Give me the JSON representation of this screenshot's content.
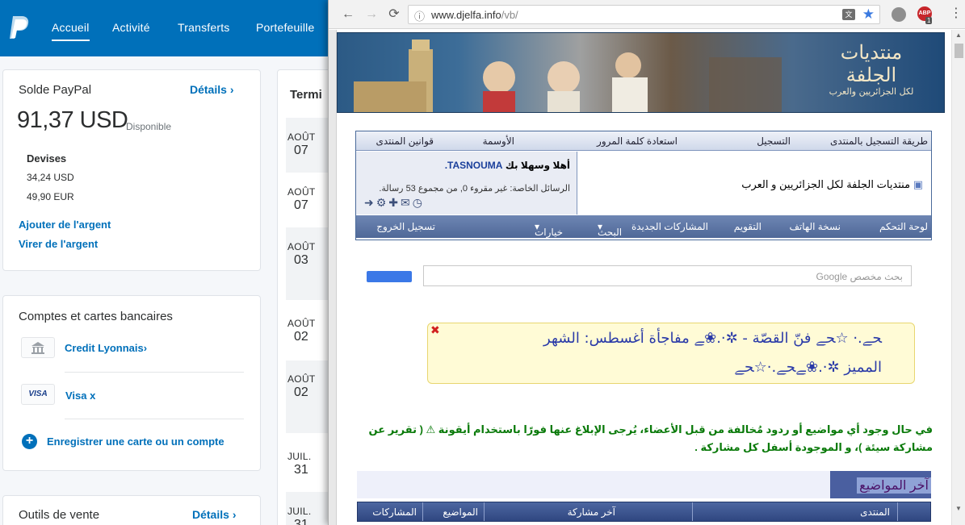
{
  "paypal": {
    "nav": [
      "Accueil",
      "Activité",
      "Transferts",
      "Portefeuille"
    ],
    "balance_card": {
      "title": "Solde PayPal",
      "details": "Détails",
      "amount": "91,37 USD",
      "available": "Disponible",
      "currencies_label": "Devises",
      "currencies": [
        "34,24 USD",
        "49,90 EUR"
      ],
      "add_money": "Ajouter de l'argent",
      "withdraw": "Virer de l'argent"
    },
    "accounts_card": {
      "title": "Comptes et cartes bancaires",
      "bank": "Credit Lyonnais",
      "card_brand": "VISA",
      "card": "Visa x",
      "register": "Enregistrer une carte ou un compte"
    },
    "sales_card": {
      "title": "Outils de vente",
      "details": "Détails"
    },
    "activity": {
      "title": "Termi",
      "dates": [
        {
          "month": "AOÛT",
          "day": "07"
        },
        {
          "month": "AOÛT",
          "day": "07"
        },
        {
          "month": "AOÛT",
          "day": "03"
        },
        {
          "month": "AOÛT",
          "day": "02"
        },
        {
          "month": "AOÛT",
          "day": "02"
        },
        {
          "month": "JUIL.",
          "day": "31"
        },
        {
          "month": "JUIL.",
          "day": "31"
        }
      ]
    }
  },
  "browser": {
    "url_host": "www.djelfa.info",
    "url_path": "/vb/",
    "ext_badge": "ABP",
    "ext_count": "1",
    "banner_title": "منتديات الجلفة",
    "banner_sub": "لكل الجزائريين والعرب",
    "top_nav": [
      "طريقة التسجيل بالمنتدى",
      "التسجيل",
      "استعادة كلمة المرور",
      "الأوسمة",
      "قوانين المنتدى"
    ],
    "forum_title": "منتديات الجلفة لكل الجزائريين و العرب",
    "welcome": "أهلا وسهلا بك",
    "username": "TASNOUMA.",
    "pm_text": "الرسائل الخاصة: غير مقروء 0, من مجموع 53 رسالة.",
    "bottom_nav": [
      "لوحة التحكم",
      "نسخة الهاتف",
      "التقويم",
      "المشاركات الجديدة",
      "البحث",
      "خيارات سريعة",
      "تسجيل الخروج"
    ],
    "search_placeholder": "Google بحث مخصص",
    "notice_line1": "ﺤﮯ.· ☆ﺤﮯ فنّ القصّة - ✲·.❀ﮯ مفاجأة أغسطس: الشهر",
    "notice_line2": "المميز ✲·.❀ﮯﺤﮯ.·☆ﺤﮯ",
    "warning": "في حال وجود أي مواضيع أو ردود مُخالفة من قبل الأعضاء، يُرجى الإبلاغ عنها فورًا باستخدام أيقونة ⚠ ( تقرير عن مشاركة سيئة )، و الموجودة أسفل كل مشاركة .",
    "latest_title": "آخر المواضيع",
    "table_headers": [
      "المنتدى",
      "آخر مشاركة",
      "المواضيع",
      "المشاركات"
    ]
  }
}
